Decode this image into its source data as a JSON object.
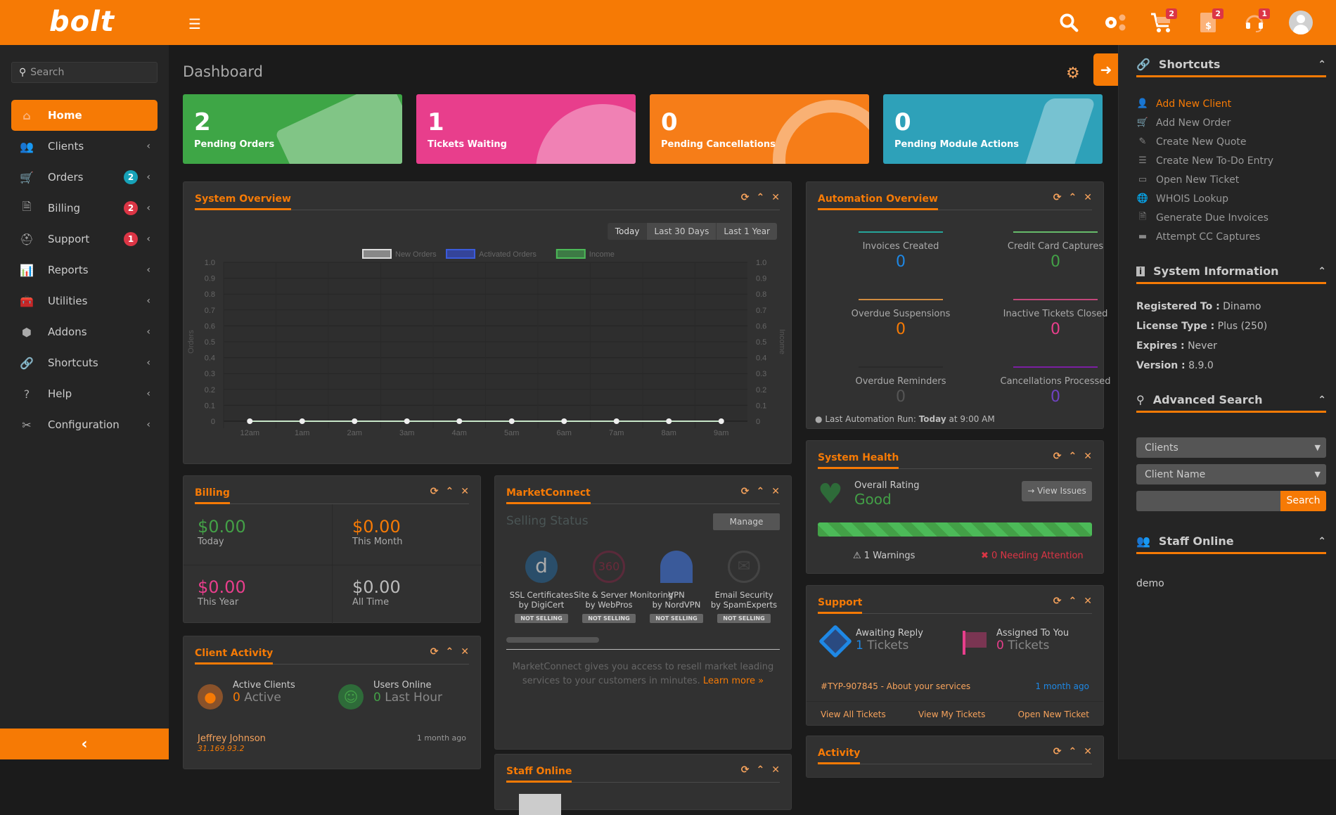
{
  "topbar": {
    "logo": "bolt",
    "menu_icon": "hamburger-icon",
    "icons": [
      {
        "name": "search-icon",
        "badge": null
      },
      {
        "name": "gears-icon",
        "badge": null
      },
      {
        "name": "cart-icon",
        "badge": "2"
      },
      {
        "name": "invoice-icon",
        "badge": "2"
      },
      {
        "name": "headset-icon",
        "badge": "1"
      },
      {
        "name": "user-avatar",
        "badge": null
      }
    ]
  },
  "sidebar": {
    "search_placeholder": "Search",
    "items": [
      {
        "label": "Home",
        "icon": "⌂",
        "active": true,
        "badge": null
      },
      {
        "label": "Clients",
        "icon": "👥",
        "badge": null
      },
      {
        "label": "Orders",
        "icon": "🛒",
        "badge": "2",
        "badge_color": "#17a2b8"
      },
      {
        "label": "Billing",
        "icon": "🗎",
        "badge": "2",
        "badge_color": "#dc3545"
      },
      {
        "label": "Support",
        "icon": "⛑",
        "badge": "1",
        "badge_color": "#dc3545"
      },
      {
        "label": "Reports",
        "icon": "📊",
        "badge": null
      },
      {
        "label": "Utilities",
        "icon": "🧰",
        "badge": null
      },
      {
        "label": "Addons",
        "icon": "⬢",
        "badge": null
      },
      {
        "label": "Shortcuts",
        "icon": "🔗",
        "badge": null
      },
      {
        "label": "Help",
        "icon": "?",
        "badge": null
      },
      {
        "label": "Configuration",
        "icon": "✂",
        "badge": null
      }
    ],
    "collapse_icon": "‹"
  },
  "main": {
    "title": "Dashboard",
    "stats": [
      {
        "value": "2",
        "label": "Pending Orders",
        "color": "#3ea646"
      },
      {
        "value": "1",
        "label": "Tickets Waiting",
        "color": "#e83e8c"
      },
      {
        "value": "0",
        "label": "Pending Cancellations",
        "color": "#f67d18"
      },
      {
        "value": "0",
        "label": "Pending Module Actions",
        "color": "#2ea1b9"
      }
    ],
    "system_overview": {
      "title": "System Overview",
      "ranges": [
        "Today",
        "Last 30 Days",
        "Last 1 Year"
      ],
      "active_range": "Today"
    },
    "automation": {
      "title": "Automation Overview",
      "items": [
        {
          "label": "Invoices Created",
          "value": "0",
          "color": "#1e88e5",
          "bar": "#26a69a"
        },
        {
          "label": "Credit Card Captures",
          "value": "0",
          "color": "#43a047",
          "bar": "#66bb6a"
        },
        {
          "label": "Overdue Suspensions",
          "value": "0",
          "color": "#f67a05",
          "bar": "#d18b3f"
        },
        {
          "label": "Inactive Tickets Closed",
          "value": "0",
          "color": "#e83e8c",
          "bar": "#c2477a"
        },
        {
          "label": "Overdue Reminders",
          "value": "0",
          "color": "#555",
          "bar": "#2a2a2a"
        },
        {
          "label": "Cancellations Processed",
          "value": "0",
          "color": "#6f42c1",
          "bar": "#7b1fa2"
        }
      ],
      "last_run_label": "Last Automation Run:",
      "last_run_day": "Today",
      "last_run_time": "at 9:00 AM"
    },
    "billing": {
      "title": "Billing",
      "cells": [
        {
          "amount": "$0.00",
          "label": "Today",
          "color": "#43a047"
        },
        {
          "amount": "$0.00",
          "label": "This Month",
          "color": "#f67a05"
        },
        {
          "amount": "$0.00",
          "label": "This Year",
          "color": "#e83e8c"
        },
        {
          "amount": "$0.00",
          "label": "All Time",
          "color": "#bbb"
        }
      ]
    },
    "marketconnect": {
      "title": "MarketConnect",
      "subtitle": "Selling Status",
      "manage": "Manage",
      "products": [
        {
          "name": "SSL Certificates",
          "by": "by DigiCert",
          "status": "NOT SELLING"
        },
        {
          "name": "Site & Server Monitoring",
          "by": "by WebPros",
          "status": "NOT SELLING"
        },
        {
          "name": "VPN",
          "by": "by NordVPN",
          "status": "NOT SELLING"
        },
        {
          "name": "Email Security",
          "by": "by SpamExperts",
          "status": "NOT SELLING"
        }
      ],
      "desc": "MarketConnect gives you access to resell market leading services to your customers in minutes.",
      "learn_more": "Learn more »"
    },
    "client_activity": {
      "title": "Client Activity",
      "active_label": "Active Clients",
      "active_value": "0",
      "active_unit": "Active",
      "online_label": "Users Online",
      "online_value": "0",
      "online_unit": "Last Hour",
      "recent": [
        {
          "name": "Jeffrey Johnson",
          "ip": "31.169.93.2",
          "time": "1 month ago"
        }
      ]
    },
    "staff_online_panel": {
      "title": "Staff Online"
    },
    "system_health": {
      "title": "System Health",
      "rating_label": "Overall Rating",
      "rating": "Good",
      "view_issues": "View Issues",
      "progress": 1.0,
      "warnings": "1 Warnings",
      "attention": "0 Needing Attention"
    },
    "support": {
      "title": "Support",
      "awaiting_label": "Awaiting Reply",
      "awaiting_value": "1",
      "awaiting_unit": "Tickets",
      "assigned_label": "Assigned To You",
      "assigned_value": "0",
      "assigned_unit": "Tickets",
      "ticket": "#TYP-907845 - About your services",
      "ticket_time": "1 month ago",
      "links": [
        "View All Tickets",
        "View My Tickets",
        "Open New Ticket"
      ]
    },
    "activity": {
      "title": "Activity"
    }
  },
  "right": {
    "shortcuts": {
      "title": "Shortcuts",
      "items": [
        {
          "label": "Add New Client",
          "icon": "👤",
          "hl": true
        },
        {
          "label": "Add New Order",
          "icon": "🛒"
        },
        {
          "label": "Create New Quote",
          "icon": "✎"
        },
        {
          "label": "Create New To-Do Entry",
          "icon": "☰"
        },
        {
          "label": "Open New Ticket",
          "icon": "▭"
        },
        {
          "label": "WHOIS Lookup",
          "icon": "🌐"
        },
        {
          "label": "Generate Due Invoices",
          "icon": "🗎"
        },
        {
          "label": "Attempt CC Captures",
          "icon": "▬"
        }
      ]
    },
    "system_info": {
      "title": "System Information",
      "rows": [
        {
          "k": "Registered To :",
          "v": "Dinamo"
        },
        {
          "k": "License Type :",
          "v": "Plus (250)"
        },
        {
          "k": "Expires :",
          "v": "Never"
        },
        {
          "k": "Version :",
          "v": "8.9.0"
        }
      ]
    },
    "advanced_search": {
      "title": "Advanced Search",
      "type_value": "Clients",
      "field_value": "Client Name",
      "query_value": "",
      "button": "Search"
    },
    "staff_online": {
      "title": "Staff Online",
      "users": [
        "demo"
      ]
    }
  },
  "chart_data": {
    "type": "line",
    "title": "System Overview",
    "x": [
      "12am",
      "1am",
      "2am",
      "3am",
      "4am",
      "5am",
      "6am",
      "7am",
      "8am",
      "9am"
    ],
    "series": [
      {
        "name": "New Orders",
        "values": [
          0,
          0,
          0,
          0,
          0,
          0,
          0,
          0,
          0,
          0
        ],
        "color": "#888888"
      },
      {
        "name": "Activated Orders",
        "values": [
          0,
          0,
          0,
          0,
          0,
          0,
          0,
          0,
          0,
          0
        ],
        "color": "#3949ab"
      },
      {
        "name": "Income",
        "values": [
          0,
          0,
          0,
          0,
          0,
          0,
          0,
          0,
          0,
          0
        ],
        "color": "#43a047"
      }
    ],
    "ylabel": "Orders",
    "y2label": "Income",
    "ylim": [
      0,
      1.0
    ],
    "yticks": [
      "1.0",
      "0.9",
      "0.8",
      "0.7",
      "0.6",
      "0.5",
      "0.4",
      "0.3",
      "0.2",
      "0.1",
      "0"
    ],
    "legend": "top",
    "grid": true
  }
}
